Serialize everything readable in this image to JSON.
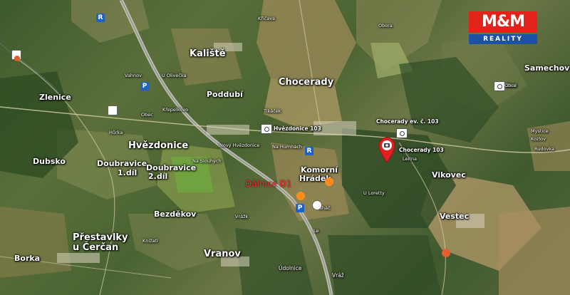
{
  "logo": {
    "top": "M&M",
    "bottom": "REALITY"
  },
  "places": {
    "kaliste": "Kaliště",
    "chocerady": "Chocerady",
    "hvezdonice": "Hvězdonice",
    "zlenice": "Zlenice",
    "dubsko": "Dubsko",
    "doubravice1_line1": "Doubravice",
    "doubravice1_line2": "1.díl",
    "doubravice2_line1": "Doubravice",
    "doubravice2_line2": "2.díl",
    "bezdekov": "Bezděkov",
    "prestavlky1": "Přestavlky",
    "prestavlky2": "u Čerčan",
    "borka": "Borka",
    "vranov": "Vranov",
    "vikovec": "Vikovec",
    "vestec": "Vestec",
    "samechov": "Samechov",
    "poddubi": "Poddubí",
    "komorni_hradek1": "Komorní",
    "komorni_hradek2": "Hrádek",
    "udolnice": "Údolnice",
    "vraz": "Vráž",
    "obora": "Obora",
    "kricava": "Křičava",
    "tikacek": "Tikáček",
    "obec": "Obec",
    "na_humna": "Na Humnách",
    "u_loretty": "U Loretty",
    "mystice": "Mystice",
    "kozlov": "Kozlov",
    "rudovka": "Rudovka",
    "u_olivecka": "U Olivečka",
    "vahnov": "Vahnov",
    "hurka": "Hůrka",
    "krepelkovo": "Křepelkovo",
    "na_slouhych": "Na Slouhých",
    "novy_hvezdonice": "Nový Hvězdonice",
    "leitna": "Leitna",
    "knizatl": "Knížatl",
    "vrazk": "Vrážk",
    "nhac": "Nháč",
    "le": "Le",
    "obol": "Obol"
  },
  "cameras": {
    "hvezdonice": "Hvězdonice 103",
    "chocerady_ev": "Chocerady ev. č. 103",
    "chocerady": "Chocerady 103",
    "obce": "Obce"
  },
  "annotation": "Dálnice D1",
  "colors": {
    "pin": "#e02020",
    "annotation": "#ff2a2a",
    "logo_red": "#e2231a",
    "logo_blue": "#1d52a3"
  }
}
